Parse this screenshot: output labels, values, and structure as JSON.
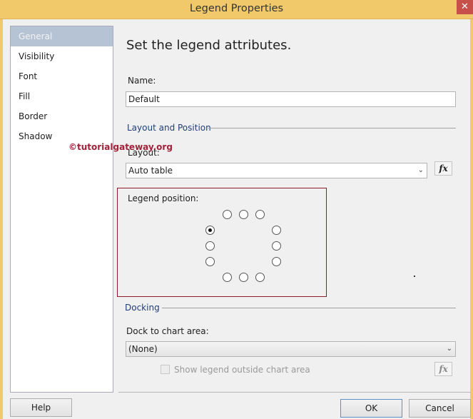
{
  "window": {
    "title": "Legend Properties",
    "close_icon": "close-icon"
  },
  "sidebar": {
    "items": [
      {
        "label": "General",
        "selected": true
      },
      {
        "label": "Visibility"
      },
      {
        "label": "Font"
      },
      {
        "label": "Fill"
      },
      {
        "label": "Border"
      },
      {
        "label": "Shadow"
      }
    ]
  },
  "main": {
    "heading": "Set the legend attributes.",
    "name_label": "Name:",
    "name_value": "Default",
    "layout_group": "Layout and Position",
    "layout_label": "Layout:",
    "layout_value": "Auto table",
    "fx_label": "fx",
    "legend_position_label": "Legend position:",
    "legend_position_selected": "left-top",
    "docking_group": "Docking",
    "dock_label": "Dock to chart area:",
    "dock_value": "(None)",
    "show_outside_label": "Show legend outside chart area",
    "show_outside_checked": false
  },
  "watermark": "©tutorialgateway.org",
  "footer": {
    "help": "Help",
    "ok": "OK",
    "cancel": "Cancel"
  }
}
